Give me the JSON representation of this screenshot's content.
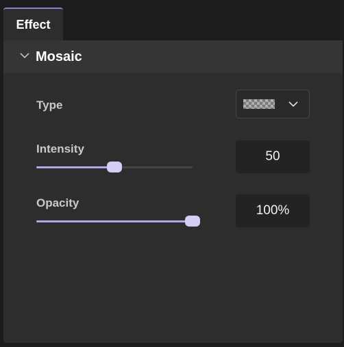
{
  "tab": {
    "label": "Effect"
  },
  "section": {
    "title": "Mosaic",
    "expanded": true
  },
  "type": {
    "label": "Type",
    "selected_icon": "mosaic-pattern-icon"
  },
  "intensity": {
    "label": "Intensity",
    "value": "50",
    "level": 0.5
  },
  "opacity": {
    "label": "Opacity",
    "value": "100%",
    "level": 1.0
  },
  "colors": {
    "accent": "#b3a8e6",
    "thumb": "#d4cdf6",
    "tab_border": "#8b7fcf",
    "panel_bg": "#2d2d2d",
    "window_bg": "#1c1c1c"
  }
}
